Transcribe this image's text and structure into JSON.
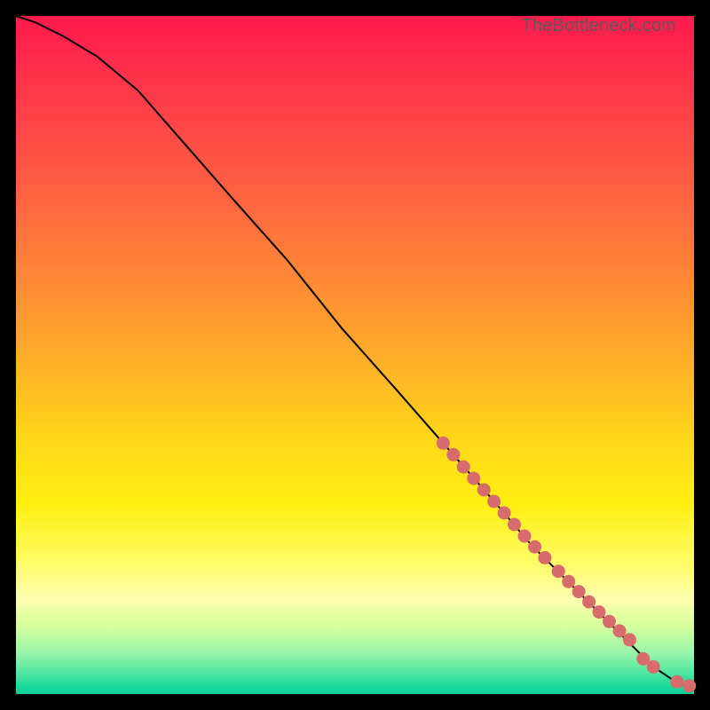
{
  "watermark": "TheBottleneck.com",
  "chart_data": {
    "type": "line",
    "title": "TheBottleneck.com",
    "xlabel": "",
    "ylabel": "",
    "xlim": [
      0,
      100
    ],
    "ylim": [
      0,
      100
    ],
    "grid": false,
    "legend": false,
    "series": [
      {
        "name": "curve",
        "style": "line",
        "color": "#000000",
        "x": [
          0,
          3,
          7,
          12,
          18,
          25,
          32,
          40,
          48,
          56,
          63,
          70,
          76,
          82,
          87,
          91,
          94,
          97,
          99,
          100
        ],
        "y": [
          100,
          99,
          97,
          94,
          89,
          81,
          73,
          64,
          54,
          45,
          37,
          29,
          22,
          16,
          11,
          7,
          4,
          2,
          1,
          1
        ]
      },
      {
        "name": "points-dense",
        "style": "scatter",
        "color": "#d86b6b",
        "x": [
          63,
          64.5,
          66,
          67.5,
          69,
          70.5,
          72,
          73.5,
          75,
          76.5,
          78,
          80,
          81.5,
          83,
          84.5,
          86,
          87.5,
          89,
          90.5
        ],
        "y": [
          37,
          35.3,
          33.5,
          31.8,
          30.1,
          28.4,
          26.7,
          25,
          23.3,
          21.7,
          20.1,
          18.1,
          16.6,
          15.1,
          13.6,
          12.1,
          10.7,
          9.3,
          8
        ]
      },
      {
        "name": "points-tail",
        "style": "scatter",
        "color": "#d86b6b",
        "x": [
          92.5,
          94,
          97.5,
          99.3
        ],
        "y": [
          5.2,
          4.0,
          1.8,
          1.2
        ]
      }
    ]
  }
}
